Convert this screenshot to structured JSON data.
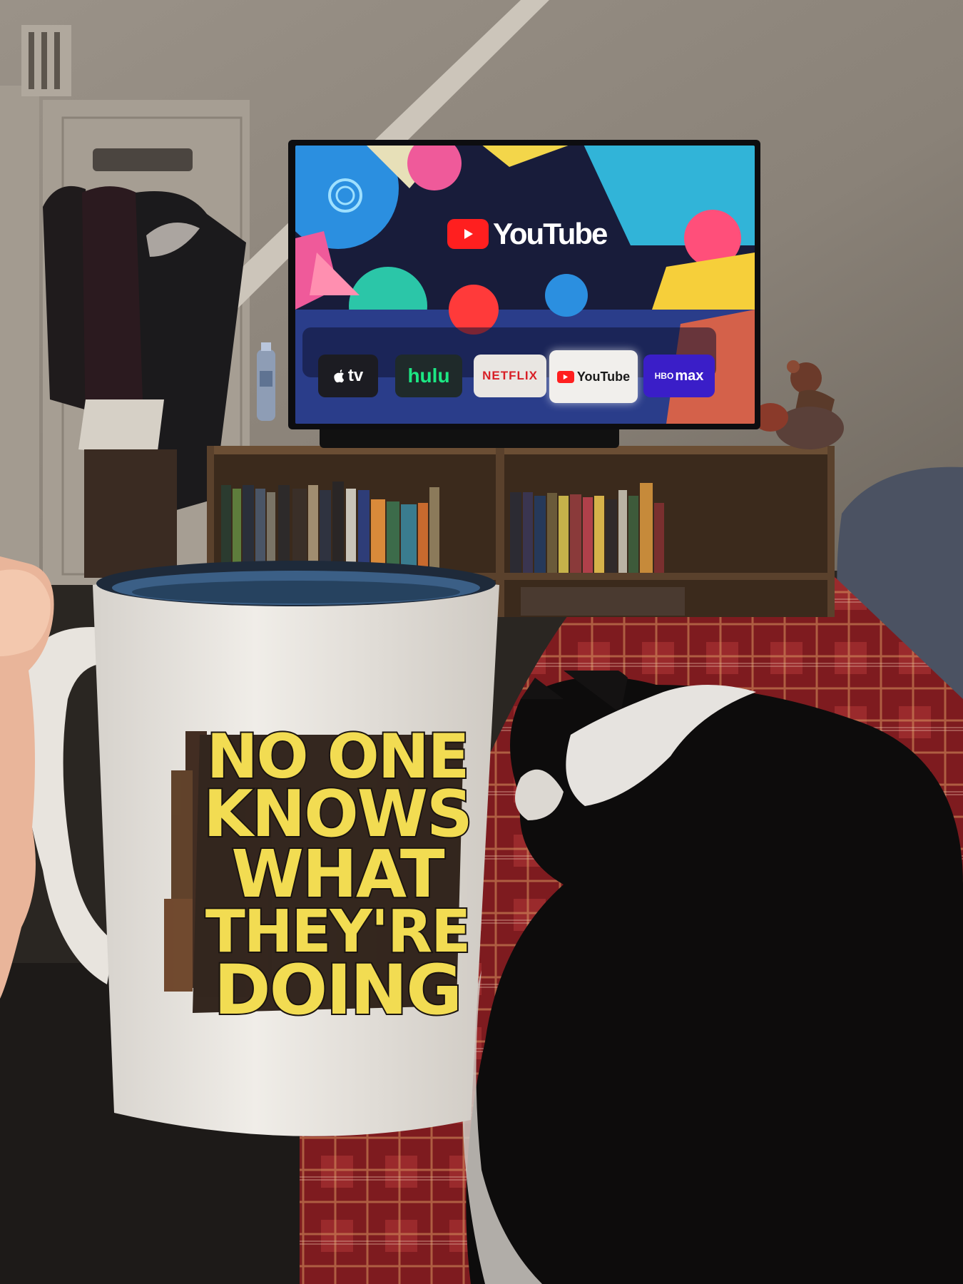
{
  "tv": {
    "brand_title": "YouTube",
    "apps": [
      {
        "label": "tv",
        "icon": "apple-icon"
      },
      {
        "label": "hulu"
      },
      {
        "label": "NETFLIX"
      },
      {
        "label": "YouTube",
        "icon": "youtube-play-icon"
      },
      {
        "label": "max",
        "icon": "hbo-icon",
        "prefix": "HBO"
      }
    ]
  },
  "mug": {
    "lines": [
      "NO ONE",
      "KNOWS",
      "WHAT",
      "THEY'RE",
      "DOING"
    ]
  },
  "colors": {
    "wall": "#8f877d",
    "mug_print": "#f2dc52",
    "blanket": "#8a1f22",
    "youtube_red": "#ff1f1f"
  }
}
